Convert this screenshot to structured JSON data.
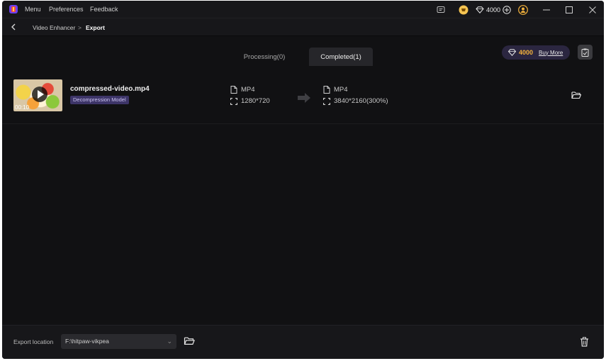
{
  "titlebar": {
    "menus": [
      "Menu",
      "Preferences",
      "Feedback"
    ],
    "credits": "4000"
  },
  "breadcrumb": {
    "parent": "Video Enhancer",
    "separator": ">",
    "current": "Export"
  },
  "tabs": {
    "processing": "Processing(0)",
    "completed": "Completed(1)"
  },
  "credits_pill": {
    "amount": "4000",
    "buy_more": "Buy More"
  },
  "items": [
    {
      "file_name": "compressed-video.mp4",
      "duration": "00:10",
      "model": "Decompression Model",
      "source": {
        "format": "MP4",
        "resolution": "1280*720"
      },
      "output": {
        "format": "MP4",
        "resolution": "3840*2160(300%)"
      }
    }
  ],
  "footer": {
    "export_label": "Export location",
    "path": "F:\\hitpaw-vikpea"
  },
  "colors": {
    "background": "#111113",
    "accent_gold": "#f5b33c",
    "tag_purple": "#3d3568"
  }
}
